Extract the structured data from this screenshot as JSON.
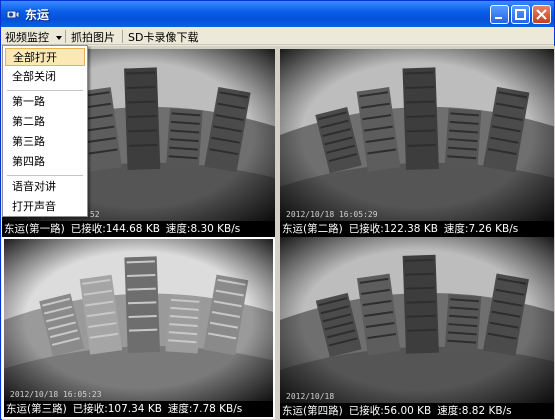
{
  "window": {
    "title": "东运",
    "colors": {
      "titlebar": "#0a5fe8",
      "menu_bg": "#ece9d8",
      "caption_bg": "#000000",
      "highlight": "#fbe8b4"
    }
  },
  "menubar": {
    "items": [
      "视频监控",
      "抓拍图片",
      "SD卡录像下载"
    ]
  },
  "dropdown": {
    "items": [
      "全部打开",
      "全部关闭",
      "第一路",
      "第二路",
      "第三路",
      "第四路",
      "语音对讲",
      "打开声音"
    ],
    "highlighted": "全部打开"
  },
  "panels": [
    {
      "name": "东运(第一路)",
      "received": "已接收:144.68 KB",
      "speed": "速度:8.30 KB/s",
      "overlay": "2012/10/18 16:05:52",
      "selected": false
    },
    {
      "name": "东运(第二路)",
      "received": "已接收:122.38 KB",
      "speed": "速度:7.26 KB/s",
      "overlay": "2012/10/18 16:05:29",
      "selected": false
    },
    {
      "name": "东运(第三路)",
      "received": "已接收:107.34 KB",
      "speed": "速度:7.78 KB/s",
      "overlay": "2012/10/18 16:05:23",
      "selected": true
    },
    {
      "name": "东运(第四路)",
      "received": "已接收:56.00 KB",
      "speed": "速度:8.82 KB/s",
      "overlay": "2012/10/18",
      "selected": false
    }
  ],
  "icons": {
    "app": "camera-icon",
    "minimize": "minimize-icon",
    "maximize": "maximize-icon",
    "close": "close-icon",
    "dropdown_arrow": "chevron-down-icon"
  }
}
